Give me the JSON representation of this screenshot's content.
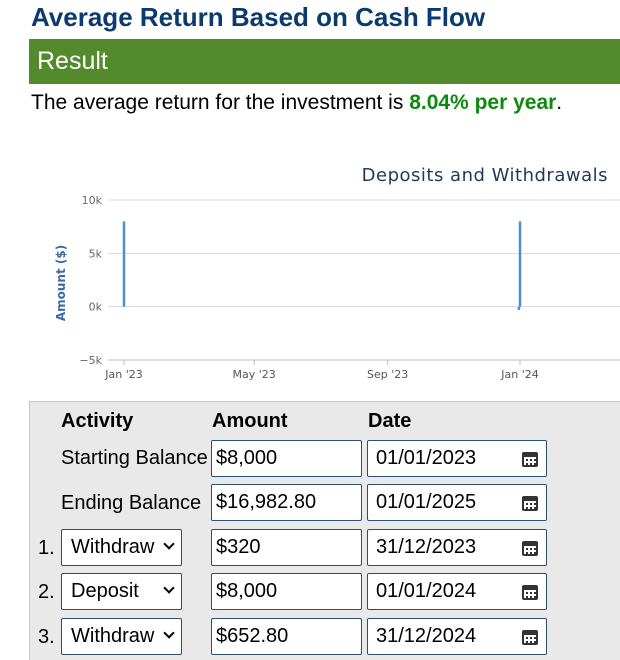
{
  "title": "Average Return Based on Cash Flow",
  "result": {
    "header": "Result",
    "sentence_prefix": "The average return for the investment is ",
    "highlight": "8.04% per year",
    "sentence_suffix": "."
  },
  "chart_data": {
    "type": "bar",
    "title": "Deposits and Withdrawals",
    "ylabel": "Amount ($)",
    "xlabel": "",
    "ylim": [
      -5000,
      10000
    ],
    "yticks": [
      {
        "value": 10000,
        "label": "10k"
      },
      {
        "value": 5000,
        "label": "5k"
      },
      {
        "value": 0,
        "label": "0k"
      },
      {
        "value": -5000,
        "label": "−5k"
      }
    ],
    "xticks": [
      {
        "date": "2023-01-01",
        "label": "Jan '23"
      },
      {
        "date": "2023-05-01",
        "label": "May '23"
      },
      {
        "date": "2023-09-01",
        "label": "Sep '23"
      },
      {
        "date": "2024-01-01",
        "label": "Jan '24"
      }
    ],
    "points": [
      {
        "date": "2023-01-01",
        "value": 8000
      },
      {
        "date": "2023-12-31",
        "value": -320
      },
      {
        "date": "2024-01-01",
        "value": 8000
      }
    ],
    "bar_color": "#4a90d9",
    "grid": true
  },
  "form": {
    "headers": {
      "activity": "Activity",
      "amount": "Amount",
      "date": "Date"
    },
    "starting": {
      "label": "Starting Balance",
      "amount": "$8,000",
      "date": "01/01/2023"
    },
    "ending": {
      "label": "Ending Balance",
      "amount": "$16,982.80",
      "date": "01/01/2025"
    },
    "rows": [
      {
        "num": "1.",
        "activity": "Withdraw",
        "amount": "$320",
        "date": "31/12/2023"
      },
      {
        "num": "2.",
        "activity": "Deposit",
        "amount": "$8,000",
        "date": "01/01/2024"
      },
      {
        "num": "3.",
        "activity": "Withdraw",
        "amount": "$652.80",
        "date": "31/12/2024"
      }
    ]
  },
  "icons": {
    "calendar": "calendar-icon",
    "dropdown": "chevron-down-icon"
  }
}
